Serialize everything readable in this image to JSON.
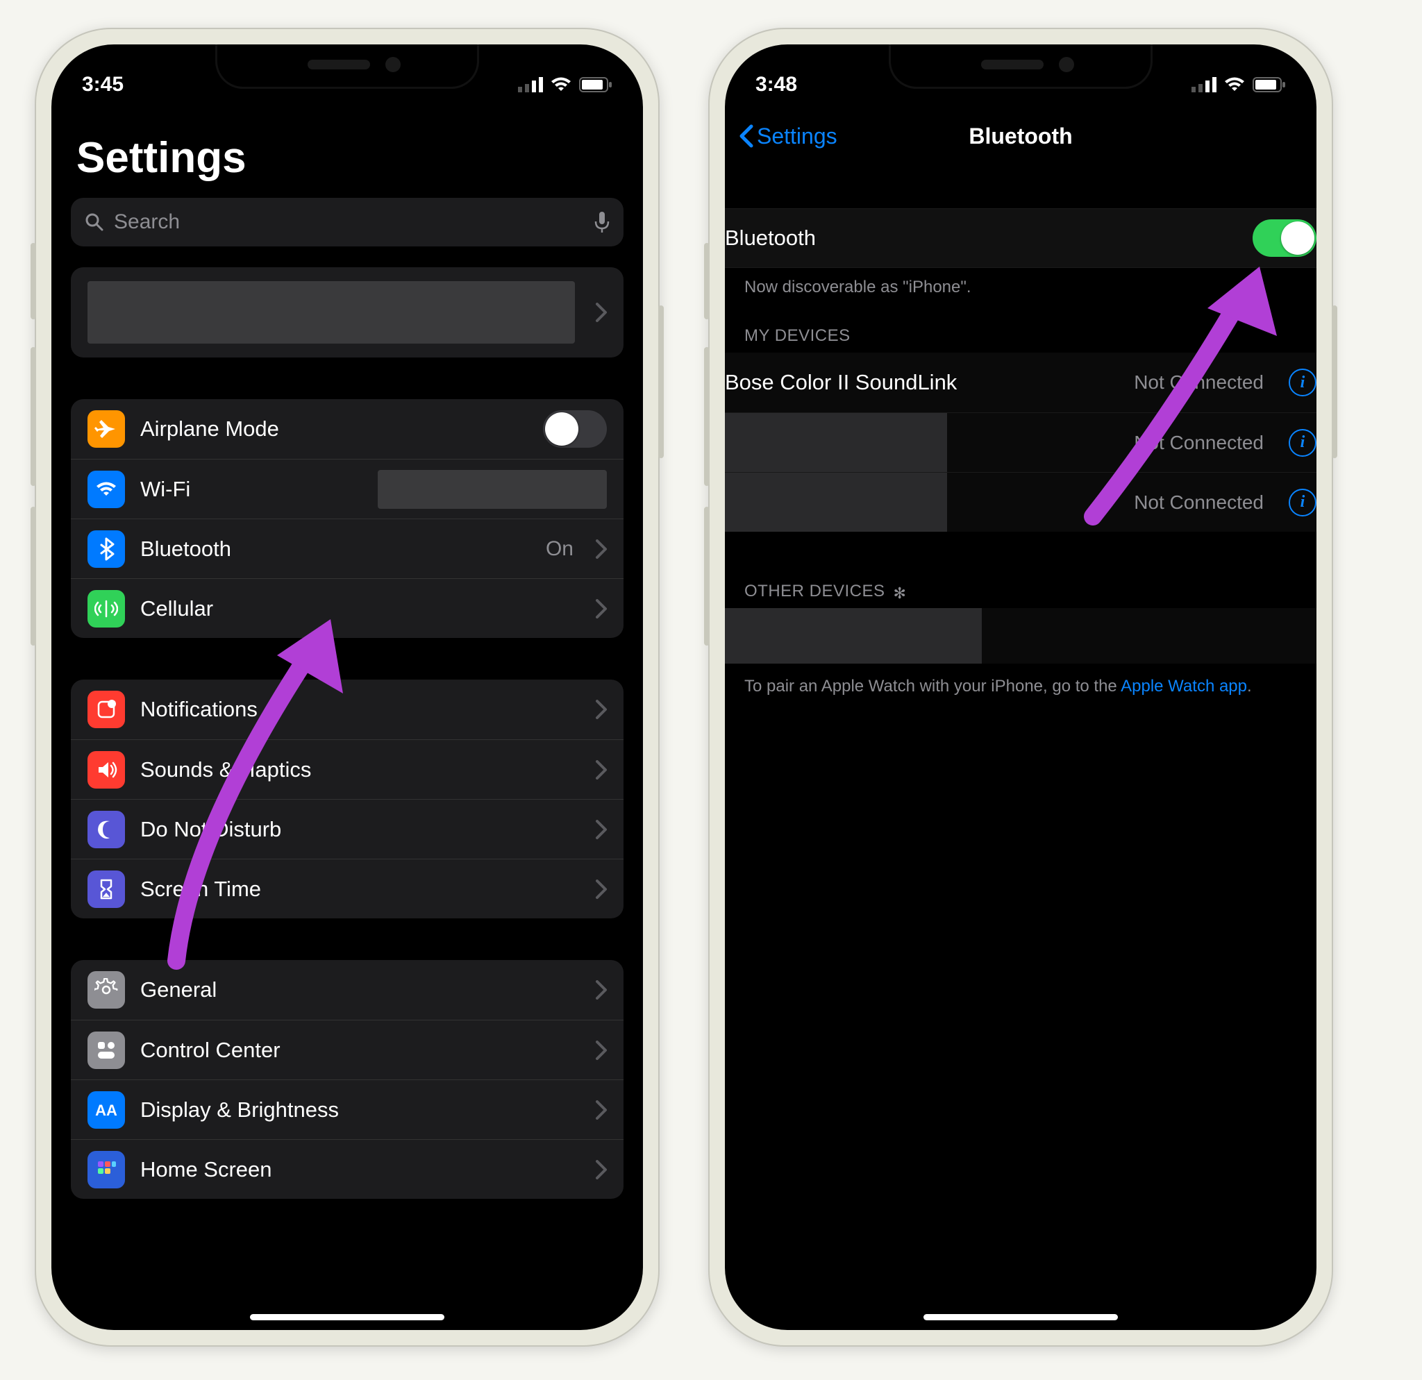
{
  "phone1": {
    "status": {
      "time": "3:45"
    },
    "title": "Settings",
    "search_placeholder": "Search",
    "groups": [
      [
        {
          "icon": "airplane",
          "color": "#ff9500",
          "label": "Airplane Mode",
          "toggle": false
        },
        {
          "icon": "wifi",
          "color": "#007aff",
          "label": "Wi-Fi",
          "redact_detail": true
        },
        {
          "icon": "bluetooth",
          "color": "#007aff",
          "label": "Bluetooth",
          "detail": "On"
        },
        {
          "icon": "cellular",
          "color": "#30d158",
          "label": "Cellular"
        }
      ],
      [
        {
          "icon": "notifications",
          "color": "#ff3b30",
          "label": "Notifications"
        },
        {
          "icon": "sounds",
          "color": "#ff3b30",
          "label": "Sounds & Haptics"
        },
        {
          "icon": "dnd",
          "color": "#5856d6",
          "label": "Do Not Disturb"
        },
        {
          "icon": "screentime",
          "color": "#5856d6",
          "label": "Screen Time"
        }
      ],
      [
        {
          "icon": "general",
          "color": "#8e8e93",
          "label": "General"
        },
        {
          "icon": "controlcenter",
          "color": "#8e8e93",
          "label": "Control Center"
        },
        {
          "icon": "display",
          "color": "#007aff",
          "label": "Display & Brightness"
        },
        {
          "icon": "homescreen",
          "color": "#2b5fd9",
          "label": "Home Screen"
        }
      ]
    ]
  },
  "phone2": {
    "status": {
      "time": "3:48"
    },
    "back_label": "Settings",
    "nav_title": "Bluetooth",
    "bt_label": "Bluetooth",
    "bt_on": true,
    "discoverable": "Now discoverable as \"iPhone\".",
    "my_devices_header": "MY DEVICES",
    "my_devices": [
      {
        "name": "Bose Color II SoundLink",
        "status": "Not Connected"
      },
      {
        "name": "",
        "status": "Not Connected",
        "redacted": true
      },
      {
        "name": "",
        "status": "Not Connected",
        "redacted": true
      }
    ],
    "other_devices_header": "OTHER DEVICES",
    "pair_text_pre": "To pair an Apple Watch with your iPhone, go to the ",
    "pair_link": "Apple Watch app",
    "pair_text_post": "."
  }
}
